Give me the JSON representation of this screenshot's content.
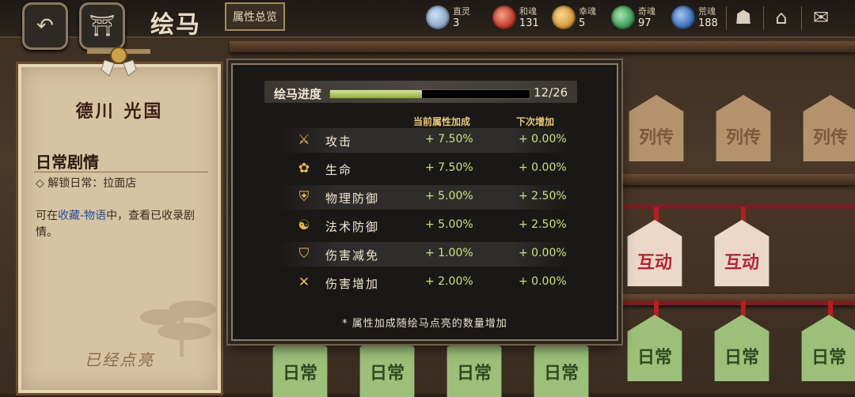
{
  "header": {
    "title": "绘马",
    "attr_overview_button": "属性总览",
    "back_icon": "back-arrow-icon",
    "home_icon": "shrine-gate-icon"
  },
  "resources": [
    {
      "name": "直灵",
      "count": "3",
      "color": "#8aa7c9"
    },
    {
      "name": "和魂",
      "count": "131",
      "color": "#c23b2a"
    },
    {
      "name": "幸魂",
      "count": "5",
      "color": "#d99a3a"
    },
    {
      "name": "奇魂",
      "count": "97",
      "color": "#3f9a5a"
    },
    {
      "name": "荒魂",
      "count": "188",
      "color": "#3c6fb5"
    }
  ],
  "top_right_icons": [
    "character-icon",
    "home-roof-icon",
    "mail-icon"
  ],
  "left_panel": {
    "character_name": "德川 光国",
    "section_title": "日常剧情",
    "unlock_text": "◇ 解锁日常：拉面店",
    "desc_prefix": "可在",
    "desc_link": "收藏-物语",
    "desc_suffix": "中，查看已收录剧情。",
    "lit_status": "已经点亮"
  },
  "ema_labels": {
    "biography": "列传",
    "interaction": "互动",
    "daily": "日常"
  },
  "popup": {
    "progress_label": "绘马进度",
    "progress_text": "12/26",
    "progress_fraction": 0.4615,
    "col_current": "当前属性加成",
    "col_next": "下次增加",
    "stats": [
      {
        "icon": "sword-icon",
        "glyph": "⚔",
        "name": "攻击",
        "current": "+ 7.50%",
        "next": "+ 0.00%"
      },
      {
        "icon": "flower-icon",
        "glyph": "✿",
        "name": "生命",
        "current": "+ 7.50%",
        "next": "+ 0.00%"
      },
      {
        "icon": "armor-icon",
        "glyph": "⛨",
        "name": "物理防御",
        "current": "+ 5.00%",
        "next": "+ 2.50%"
      },
      {
        "icon": "yin-yang-icon",
        "glyph": "☯",
        "name": "法术防御",
        "current": "+ 5.00%",
        "next": "+ 2.50%"
      },
      {
        "icon": "shield-icon",
        "glyph": "⛉",
        "name": "伤害减免",
        "current": "+ 1.00%",
        "next": "+ 0.00%"
      },
      {
        "icon": "crossed-swords-icon",
        "glyph": "✕",
        "name": "伤害增加",
        "current": "+ 2.00%",
        "next": "+ 0.00%"
      }
    ],
    "note": "* 属性加成随绘马点亮的数量增加"
  }
}
